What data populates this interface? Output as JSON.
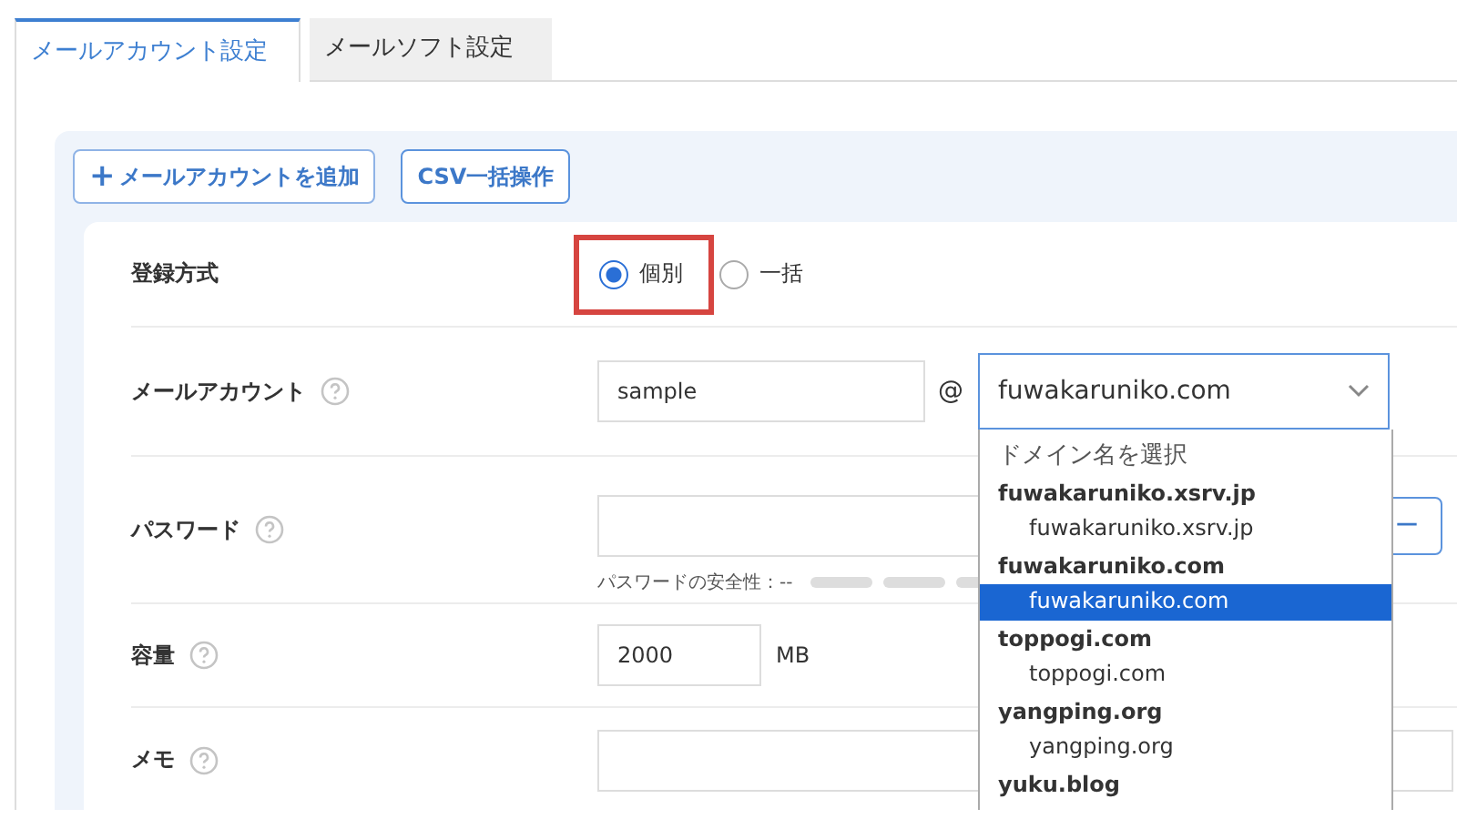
{
  "tabs": [
    {
      "label": "メールアカウント設定",
      "selected": true
    },
    {
      "label": "メールソフト設定",
      "selected": false
    }
  ],
  "toolbar": {
    "buttons": [
      {
        "label": "メールアカウントを追加",
        "icon_text": "+"
      },
      {
        "label": "CSV一括操作"
      }
    ]
  },
  "form": {
    "rows": [
      {
        "kind": "radio",
        "label": "登録方式",
        "help": false,
        "highlighted": true,
        "options": [
          {
            "label": "個別",
            "selected": true
          },
          {
            "label": "一括",
            "selected": false
          }
        ]
      },
      {
        "kind": "account",
        "label": "メールアカウント",
        "help": true,
        "value": "sample",
        "at": "@",
        "domain": "fuwakaruniko.com",
        "expanded": true
      },
      {
        "kind": "password",
        "label": "パスワード",
        "help": true,
        "strength_label": "パスワードの安全性：--",
        "button": "ー"
      },
      {
        "kind": "quota",
        "label": "容量",
        "help": true,
        "value": "2000",
        "unit": "MB"
      },
      {
        "kind": "memo",
        "label": "メモ",
        "help": true
      }
    ]
  },
  "domain_dropdown": {
    "placeholder": "ドメイン名を選択",
    "groups": [
      {
        "label": "fuwakaruniko.xsrv.jp",
        "options": [
          {
            "label": "fuwakaruniko.xsrv.jp",
            "selected": false
          }
        ]
      },
      {
        "label": "fuwakaruniko.com",
        "options": [
          {
            "label": "fuwakaruniko.com",
            "selected": true
          }
        ]
      },
      {
        "label": "toppogi.com",
        "options": [
          {
            "label": "toppogi.com",
            "selected": false
          }
        ]
      },
      {
        "label": "yangping.org",
        "options": [
          {
            "label": "yangping.org",
            "selected": false
          }
        ]
      },
      {
        "label": "yuku.blog"
      }
    ]
  }
}
